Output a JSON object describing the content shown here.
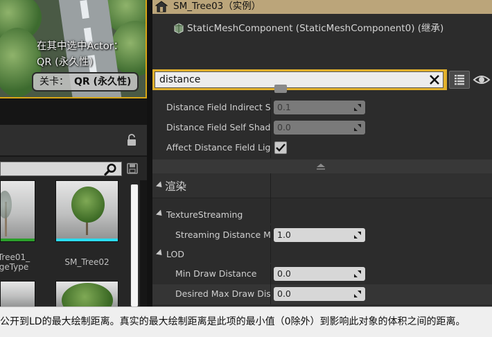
{
  "viewport": {
    "selected_line1": "在其中选中Actor：",
    "selected_line2": "QR (永久性)",
    "level_label": "关卡：",
    "level_value": "QR (永久性)"
  },
  "content_browser": {
    "assets": [
      {
        "label_line1": "Tree01_",
        "label_line2": "geType",
        "bar_color": "#2aa02a"
      },
      {
        "label_line1": "SM_Tree02",
        "label_line2": "",
        "bar_color": "#2bdcf0"
      }
    ]
  },
  "details": {
    "actor_name": "SM_Tree03（实例）",
    "component_name": "StaticMeshComponent (StaticMeshComponent0) (继承)",
    "search": {
      "value": "distance",
      "placeholder": ""
    },
    "properties": {
      "distance_field_indirect_shadow": {
        "label": "Distance Field Indirect Shadow",
        "value": "0.1"
      },
      "distance_field_self_shadow": {
        "label": "Distance Field Self Shadow",
        "value": "0.0"
      },
      "affect_distance_field_lighting": {
        "label": "Affect Distance Field Lighting",
        "checked": true
      },
      "category_render": "渲染",
      "subcategory_texture_streaming": "TextureStreaming",
      "streaming_distance_multiplier": {
        "label": "Streaming Distance Multiplier",
        "value": "1.0"
      },
      "subcategory_lod": "LOD",
      "min_draw_distance": {
        "label": "Min Draw Distance",
        "value": "0.0"
      },
      "desired_max_draw_distance": {
        "label": "Desired Max Draw Distance",
        "value": "0.0"
      }
    }
  },
  "tooltip": "公开到LD的最大绘制距离。真实的最大绘制距离是此项的最小值（0除外）到影响此对象的体积之间的距离。",
  "colors": {
    "selection_border": "#e2b12c",
    "actor_header": "#bba57a",
    "panel_bg": "#2c2c2c"
  },
  "icons": [
    "actor-icon",
    "static-mesh-icon",
    "clear-icon",
    "list-view-icon",
    "eye-icon",
    "lock-icon",
    "search-icon",
    "save-icon",
    "drag-handle-icon",
    "checkmark-icon",
    "collapse-arrow-icon"
  ]
}
